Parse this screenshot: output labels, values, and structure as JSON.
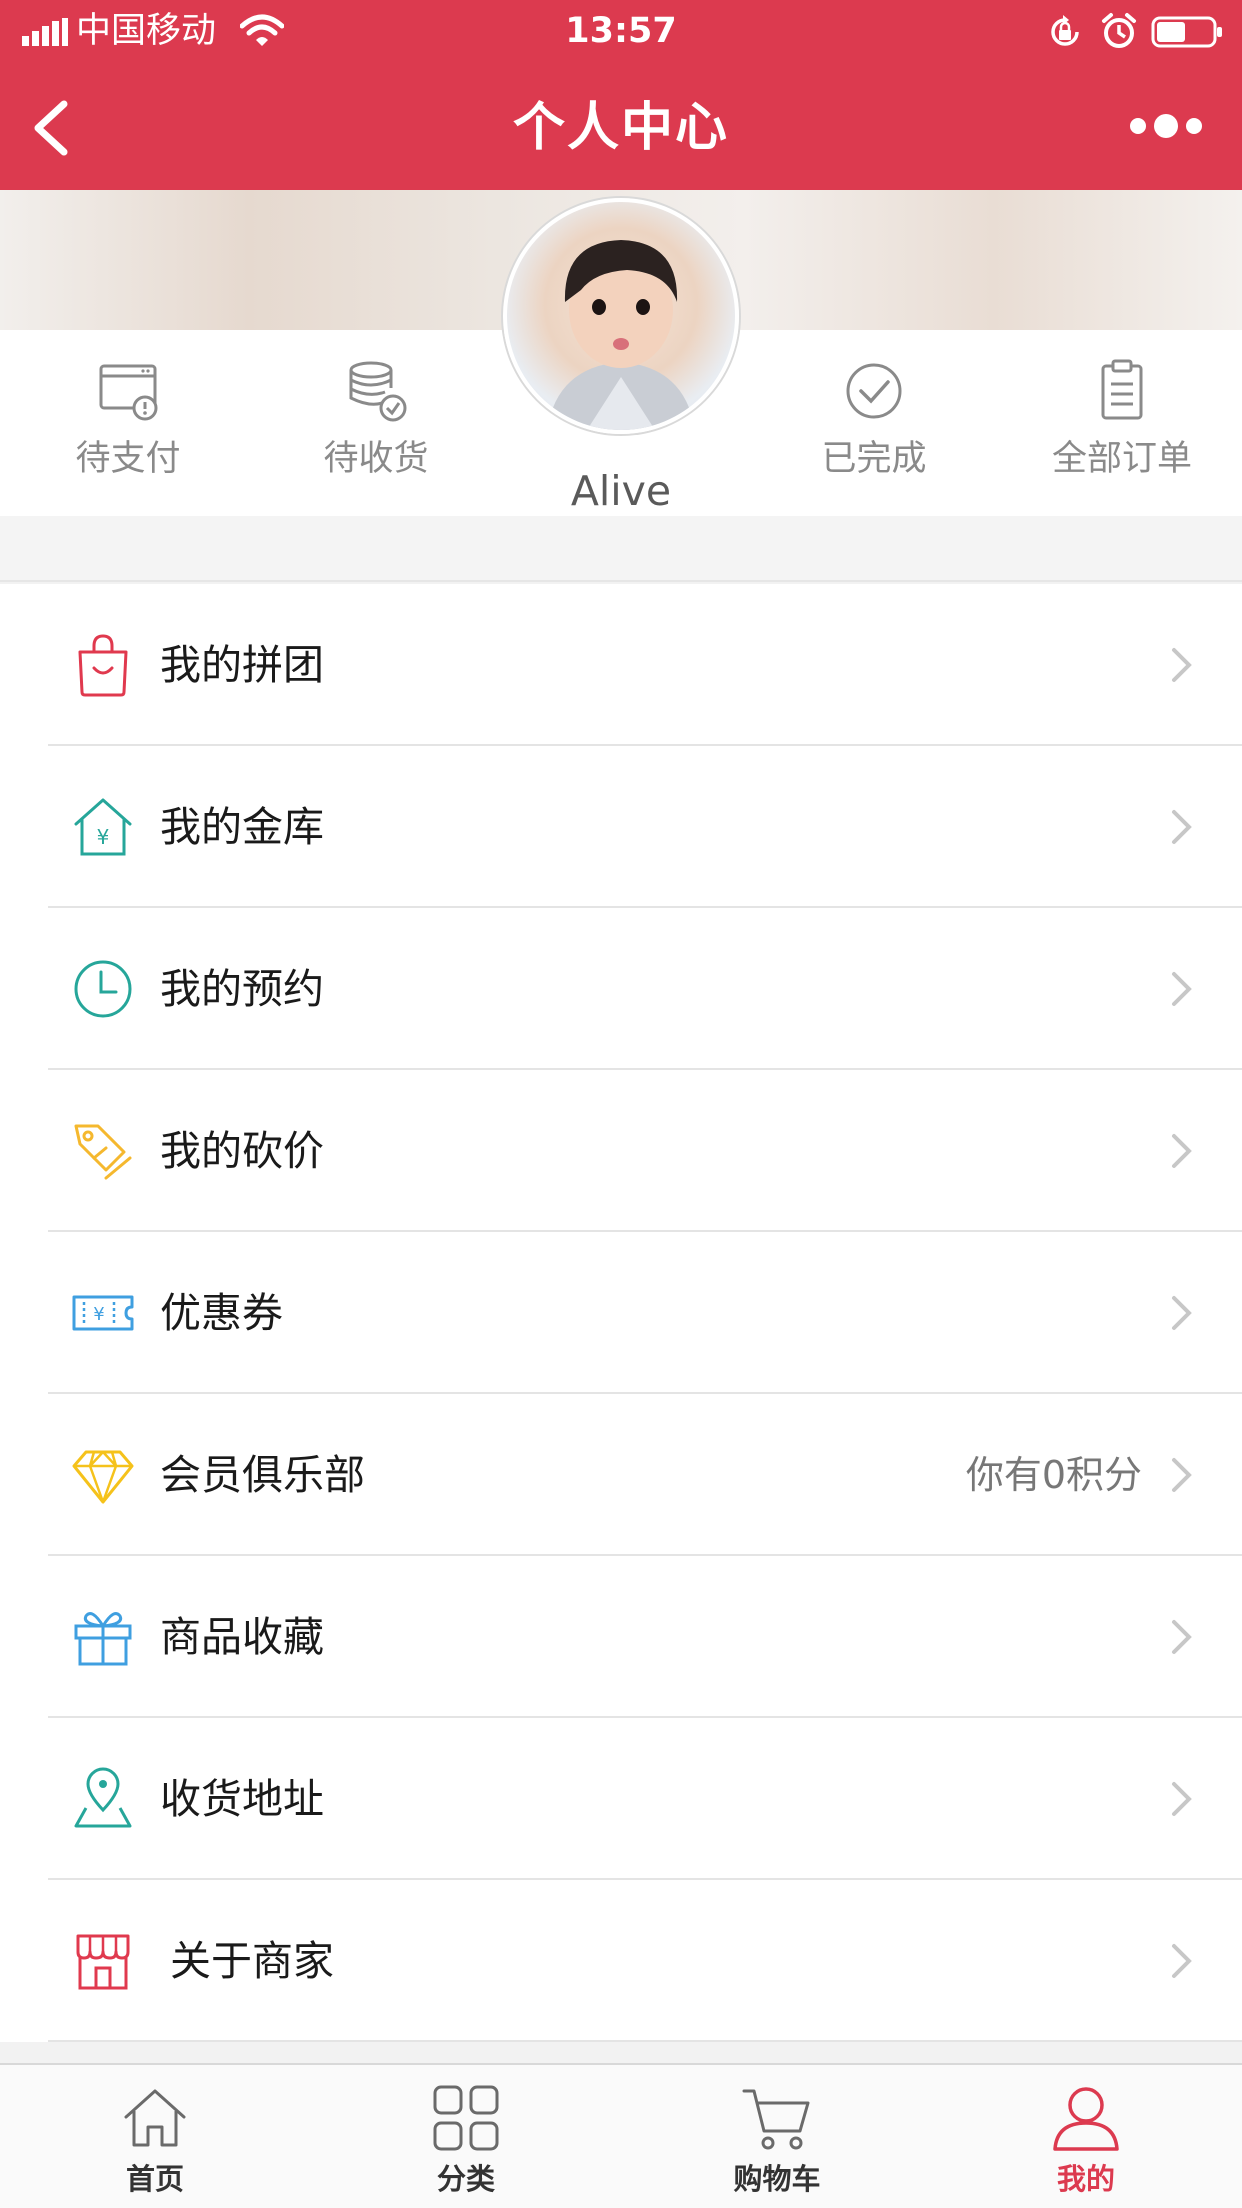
{
  "status_bar": {
    "carrier": "中国移动",
    "time": "13:57"
  },
  "nav": {
    "title": "个人中心",
    "back_icon": "chevron-left-icon",
    "more_icon": "more-dots-icon"
  },
  "profile": {
    "username": "Alive"
  },
  "orders": [
    {
      "label": "待支付",
      "icon": "pending-payment-icon"
    },
    {
      "label": "待收货",
      "icon": "pending-delivery-icon"
    },
    {
      "label": "已完成",
      "icon": "check-circle-icon"
    },
    {
      "label": "全部订单",
      "icon": "clipboard-icon"
    }
  ],
  "menu": [
    {
      "label": "我的拼团",
      "icon": "shopping-bag-icon",
      "color": "#e0394e"
    },
    {
      "label": "我的金库",
      "icon": "vault-house-icon",
      "color": "#26a69a"
    },
    {
      "label": "我的预约",
      "icon": "clock-icon",
      "color": "#26a69a"
    },
    {
      "label": "我的砍价",
      "icon": "price-tag-icon",
      "color": "#f5b82e"
    },
    {
      "label": "优惠券",
      "icon": "coupon-icon",
      "color": "#3f9fe0"
    },
    {
      "label": "会员俱乐部",
      "extra": "你有0积分",
      "icon": "diamond-icon",
      "color": "#f5c21b"
    },
    {
      "label": "商品收藏",
      "icon": "gift-icon",
      "color": "#3f9fe0"
    },
    {
      "label": "收货地址",
      "icon": "map-pin-icon",
      "color": "#26a69a"
    },
    {
      "label": "关于商家",
      "icon": "store-icon",
      "color": "#e0394e"
    }
  ],
  "tabs": [
    {
      "label": "首页",
      "icon": "home-icon"
    },
    {
      "label": "分类",
      "icon": "grid-icon"
    },
    {
      "label": "购物车",
      "icon": "cart-icon"
    },
    {
      "label": "我的",
      "icon": "user-icon",
      "active": true
    }
  ],
  "colors": {
    "brand": "#dc3a4f",
    "background": "#f2f2f2"
  }
}
